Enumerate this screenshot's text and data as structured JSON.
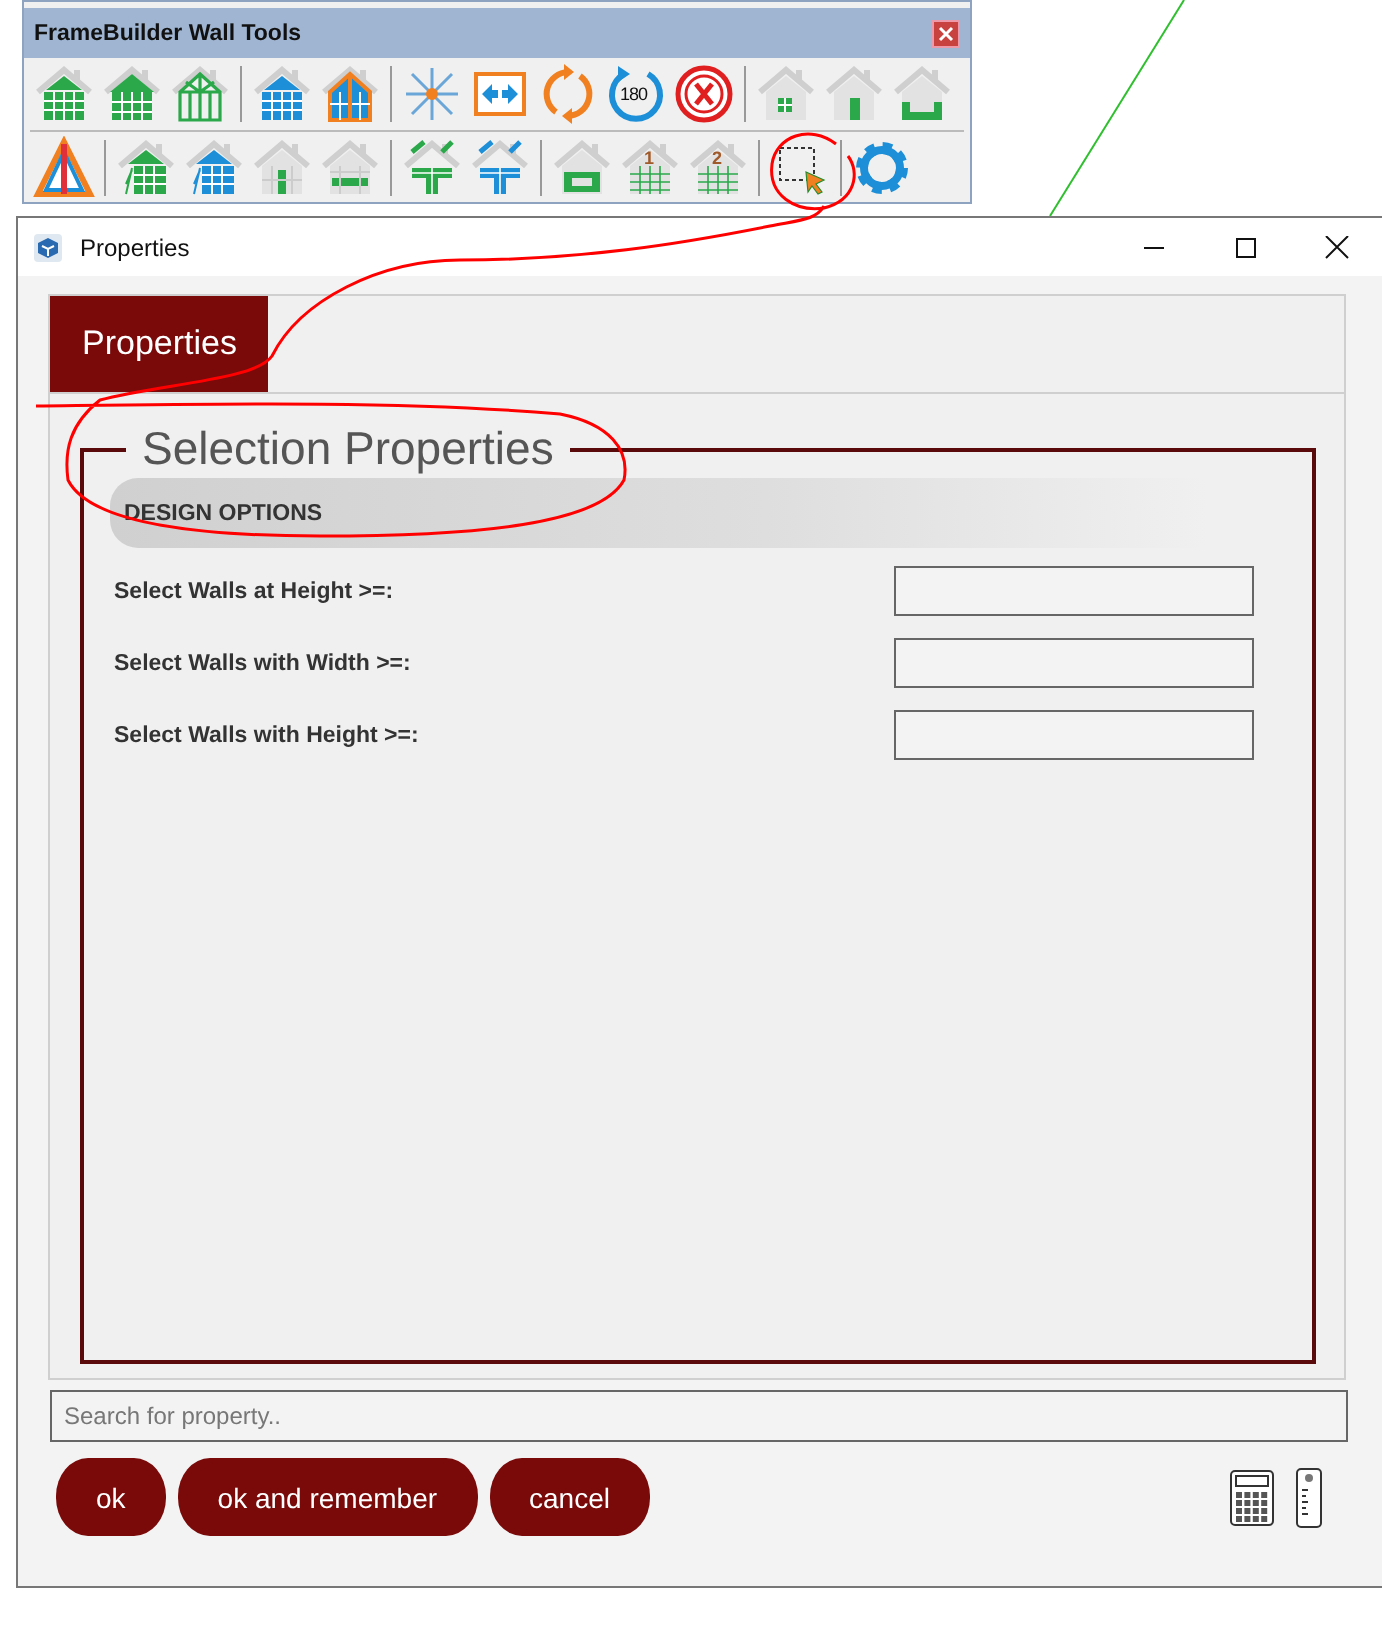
{
  "toolbar": {
    "title": "FrameBuilder Wall Tools",
    "rows": [
      [
        {
          "kind": "house-grid-green"
        },
        {
          "kind": "house-solid-green"
        },
        {
          "kind": "house-frame-green"
        },
        {
          "kind": "separator"
        },
        {
          "kind": "house-grid-blue"
        },
        {
          "kind": "house-split-blue"
        },
        {
          "kind": "separator"
        },
        {
          "kind": "move"
        },
        {
          "kind": "swap"
        },
        {
          "kind": "rotate"
        },
        {
          "kind": "rotate-180",
          "label": "180"
        },
        {
          "kind": "delete"
        },
        {
          "kind": "separator"
        },
        {
          "kind": "house-window"
        },
        {
          "kind": "house-door"
        },
        {
          "kind": "house-notch"
        }
      ],
      [
        {
          "kind": "triangle"
        },
        {
          "kind": "separator"
        },
        {
          "kind": "house-hatch-green"
        },
        {
          "kind": "house-hatch-blue"
        },
        {
          "kind": "house-stud"
        },
        {
          "kind": "house-header"
        },
        {
          "kind": "separator"
        },
        {
          "kind": "house-t-green"
        },
        {
          "kind": "house-t-blue"
        },
        {
          "kind": "separator"
        },
        {
          "kind": "house-box"
        },
        {
          "kind": "house-lines",
          "label": "1"
        },
        {
          "kind": "house-lines",
          "label": "2"
        },
        {
          "kind": "separator"
        },
        {
          "kind": "select"
        },
        {
          "kind": "separator"
        },
        {
          "kind": "gear"
        }
      ]
    ]
  },
  "window": {
    "title": "Properties"
  },
  "tabs": [
    {
      "label": "Properties",
      "selected": true
    }
  ],
  "group": {
    "title": "Selection Properties",
    "section": "DESIGN OPTIONS",
    "fields": [
      {
        "label": "Select Walls at Height >=:"
      },
      {
        "label": "Select Walls with Width >=:"
      },
      {
        "label": "Select Walls with Height >=:"
      }
    ]
  },
  "search": {
    "placeholder": "Search for property.."
  },
  "buttons": [
    "ok",
    "ok and remember",
    "cancel"
  ]
}
